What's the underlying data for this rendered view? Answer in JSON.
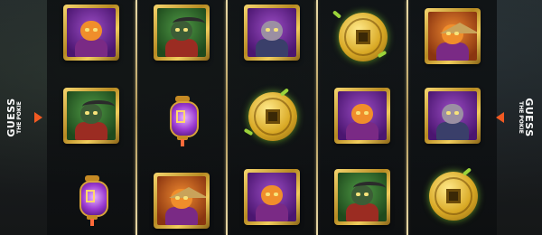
{
  "brand": {
    "left_badge": {
      "line1": "GUESS",
      "line2": "THE POKIE"
    },
    "right_badge": {
      "line1": "GUESS",
      "line2": "THE POKIE"
    },
    "arrow_color": "#f15a22"
  },
  "reels": [
    {
      "symbols": [
        "tiger-purple-frame",
        "bull-green-frame",
        "purple-lantern"
      ]
    },
    {
      "symbols": [
        "bull-green-frame",
        "purple-lantern",
        "tiger-orange-frame"
      ]
    },
    {
      "symbols": [
        "rat-purple-frame",
        "gold-coin",
        "tiger-purple-frame"
      ]
    },
    {
      "symbols": [
        "gold-coin",
        "tiger-purple-frame",
        "bull-green-frame"
      ]
    },
    {
      "symbols": [
        "tiger-orange-frame",
        "rat-purple-frame",
        "gold-coin"
      ]
    }
  ],
  "colors": {
    "divider_gold": "#e8d9a8",
    "frame_gold": "#d9a925",
    "background": "#1b1e21"
  }
}
